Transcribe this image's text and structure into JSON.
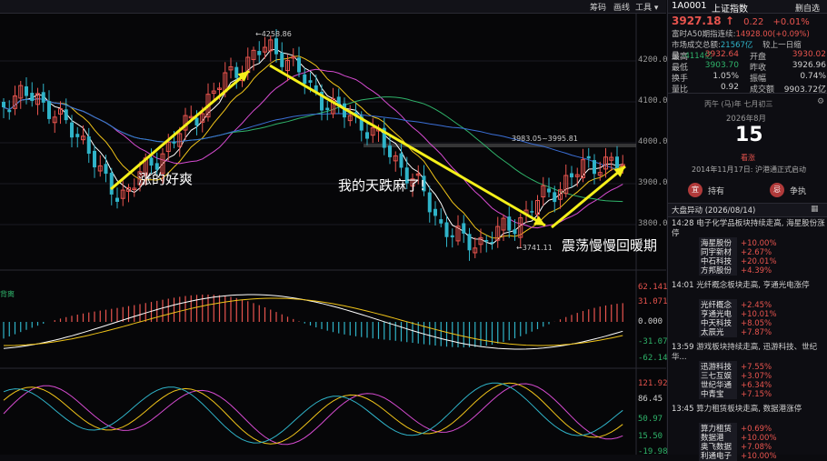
{
  "toolbar": {
    "menu_1": "筹码",
    "menu_2": "画线",
    "menu_3": "工具 ▾",
    "icon_1": "gear-icon",
    "icon_2": "settings-icon"
  },
  "main_chart": {
    "high_label": "←4258.86",
    "low_label": "←3741.11",
    "range_label": "3983.05~3995.81",
    "price_axis": [
      "4200.00",
      "4100.00",
      "4000.00",
      "3900.00",
      "3800.00"
    ],
    "annotations": {
      "rise": "涨的好爽",
      "fall": "我的天跌麻了!",
      "range": "震荡慢慢回暖期"
    }
  },
  "macd_panel": {
    "tag": "背离",
    "axis": [
      "62.141",
      "31.071",
      "0.000",
      "-31.071",
      "-62.141"
    ]
  },
  "kdj_panel": {
    "axis": [
      "121.92",
      "86.45",
      "50.97",
      "15.50",
      "-19.98"
    ]
  },
  "quote": {
    "code": "1A0001",
    "name": "上证指数",
    "menu": "删自选",
    "price": "3927.18",
    "arrow": "↑",
    "change": "0.22",
    "change_pct": "+0.01%",
    "fuquan_label": "富时A50期指连续:",
    "fuquan_value": "14928.00(+0.09%)",
    "turnover_label": "市场成交总额:",
    "turnover_value": "21567亿",
    "compare_label": "较上一日缩量:",
    "compare_value": "-4114亿",
    "rows": [
      {
        "l1": "最高",
        "v1": "3932.64",
        "c1": "red",
        "l2": "开盘",
        "v2": "3930.02",
        "c2": "red"
      },
      {
        "l1": "最低",
        "v1": "3903.70",
        "c1": "green",
        "l2": "昨收",
        "v2": "3926.96",
        "c2": "white"
      },
      {
        "l1": "换手",
        "v1": "1.05%",
        "c1": "white",
        "l2": "振幅",
        "v2": "0.74%",
        "c2": "white"
      },
      {
        "l1": "量比",
        "v1": "0.92",
        "c1": "white",
        "l2": "成交额",
        "v2": "9903.72亿",
        "c2": "white"
      }
    ]
  },
  "calendar": {
    "lunar": "丙午 (马)年 七月初三",
    "month": "2026年8月",
    "day": "15",
    "label": "看涨",
    "event": "2014年11月17日: 沪港通正式启动",
    "btn_hold": "持有",
    "btn_dispute": "争执"
  },
  "news": {
    "header": "大盘异动 (2026/08/14)",
    "items": [
      {
        "time": "14:28",
        "text": "电子化学品板块持续走高, 海星股份涨停",
        "stocks": [
          {
            "name": "海星股份",
            "pct": "+10.00%"
          },
          {
            "name": "同宇新材",
            "pct": "+2.67%"
          },
          {
            "name": "中石科技",
            "pct": "+20.01%"
          },
          {
            "name": "方邦股份",
            "pct": "+4.39%"
          }
        ]
      },
      {
        "time": "14:01",
        "text": "光纤概念板块走高, 亨通光电涨停",
        "stocks": [
          {
            "name": "光纤概念",
            "pct": "+2.45%"
          },
          {
            "name": "亨通光电",
            "pct": "+10.01%"
          },
          {
            "name": "中天科技",
            "pct": "+8.05%"
          },
          {
            "name": "太辰光",
            "pct": "+7.87%"
          }
        ]
      },
      {
        "time": "13:59",
        "text": "游戏板块持续走高, 迅游科技、世纪华...",
        "stocks": [
          {
            "name": "迅游科技",
            "pct": "+7.55%"
          },
          {
            "name": "三七互娱",
            "pct": "+3.07%"
          },
          {
            "name": "世纪华通",
            "pct": "+6.34%"
          },
          {
            "name": "中青宝",
            "pct": "+7.15%"
          }
        ]
      },
      {
        "time": "13:45",
        "text": "算力租赁板块走高, 数据港涨停",
        "stocks": [
          {
            "name": "算力租赁",
            "pct": "+0.69%"
          },
          {
            "name": "数据港",
            "pct": "+10.00%"
          },
          {
            "name": "奥飞数据",
            "pct": "+7.08%"
          },
          {
            "name": "利通电子",
            "pct": "+10.00%"
          }
        ]
      }
    ]
  },
  "colors": {
    "up": "#e8544e",
    "down": "#2fb3c8",
    "arrow": "#f5f01a",
    "ma5": "#ffffff",
    "ma10": "#f0c419",
    "ma20": "#d54bd0",
    "ma60": "#2fb36a"
  }
}
